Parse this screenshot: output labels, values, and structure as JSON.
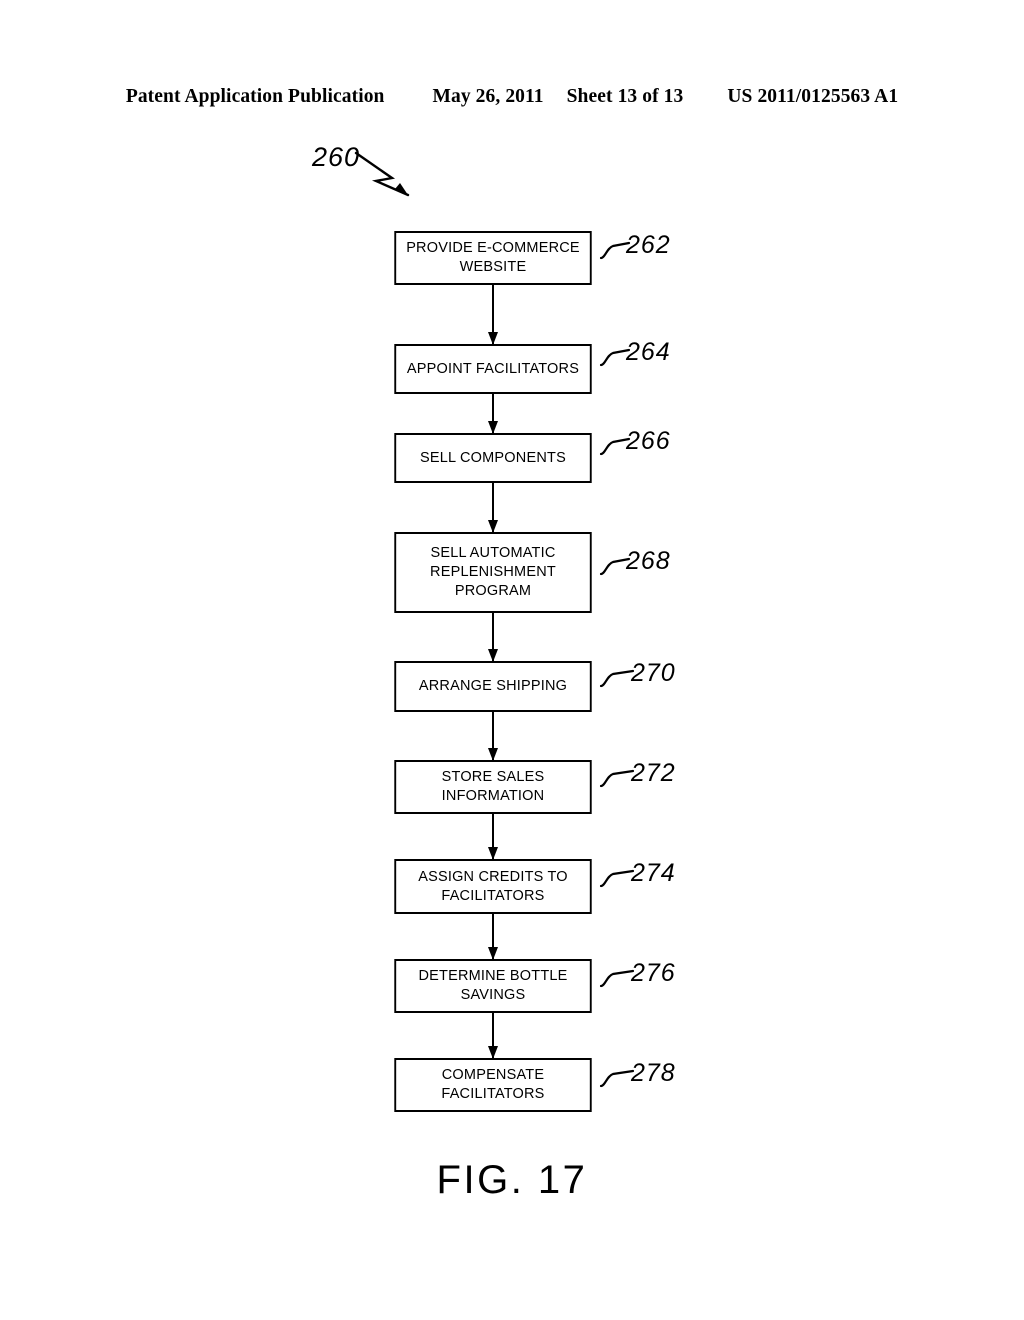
{
  "header": {
    "publication": "Patent Application Publication",
    "date": "May 26, 2011",
    "sheet": "Sheet 13 of 13",
    "patent_number": "US 2011/0125563 A1"
  },
  "figure": {
    "caption": "FIG. 17",
    "diagram_label": "260",
    "steps": [
      {
        "ref": "262",
        "text": "PROVIDE E-COMMERCE\nWEBSITE"
      },
      {
        "ref": "264",
        "text": "APPOINT FACILITATORS"
      },
      {
        "ref": "266",
        "text": "SELL COMPONENTS"
      },
      {
        "ref": "268",
        "text": "SELL AUTOMATIC\nREPLENISHMENT\nPROGRAM"
      },
      {
        "ref": "270",
        "text": "ARRANGE SHIPPING"
      },
      {
        "ref": "272",
        "text": "STORE SALES\nINFORMATION"
      },
      {
        "ref": "274",
        "text": "ASSIGN CREDITS TO\nFACILITATORS"
      },
      {
        "ref": "276",
        "text": "DETERMINE BOTTLE\nSAVINGS"
      },
      {
        "ref": "278",
        "text": "COMPENSATE\nFACILITATORS"
      }
    ]
  },
  "colors": {
    "ink": "#000000",
    "page": "#ffffff"
  }
}
